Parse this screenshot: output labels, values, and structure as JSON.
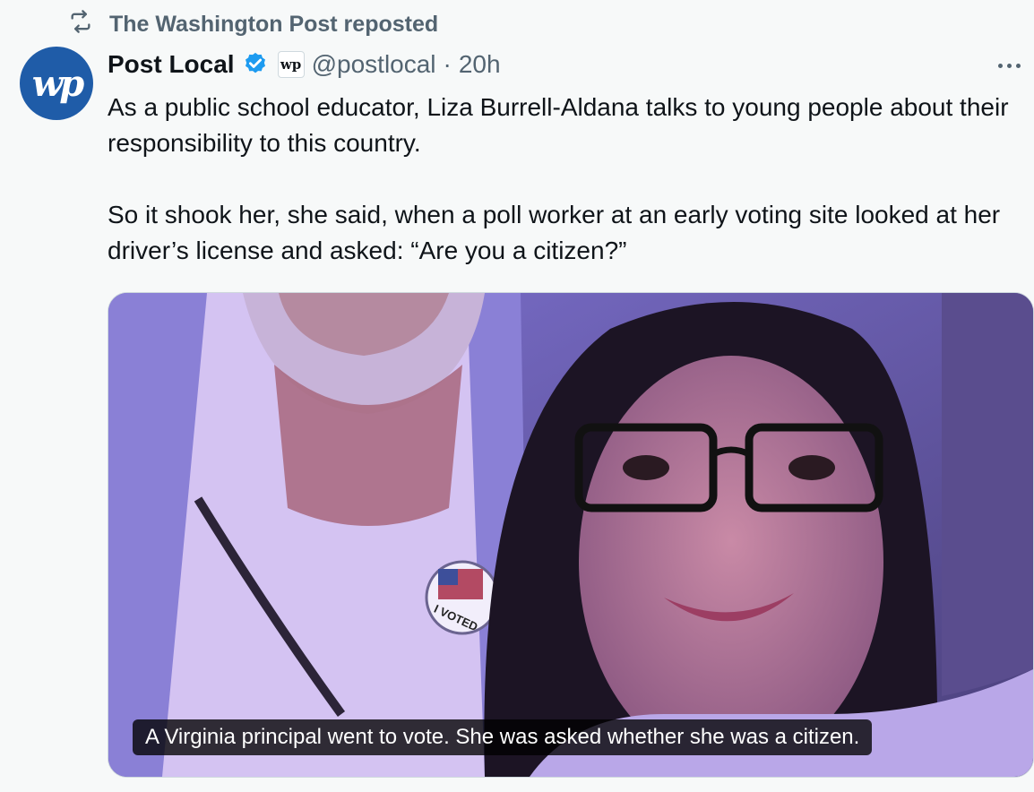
{
  "repost": {
    "icon": "repost-icon",
    "text": "The Washington Post reposted"
  },
  "author": {
    "avatar_text": "wp",
    "name": "Post Local",
    "verified_icon": "verified-badge-icon",
    "affiliate_badge": "wp",
    "handle": "@postlocal",
    "separator": "·",
    "time": "20h"
  },
  "more_icon": "more-options-icon",
  "tweet": {
    "paragraph_1": "As a public school educator, Liza Burrell-Aldana talks to young people about their responsibility to this country.",
    "paragraph_2": "So it shook her, she said, when a poll worker at an early voting site looked at her driver’s license and asked: “Are you a citizen?”"
  },
  "media": {
    "sticker_text": "I VOTED",
    "caption": "A Virginia principal went to vote. She was asked whether she was a citizen."
  },
  "colors": {
    "accent": "#1d9bf0",
    "avatar_bg": "#1f5ca8",
    "secondary_text": "#536471"
  }
}
